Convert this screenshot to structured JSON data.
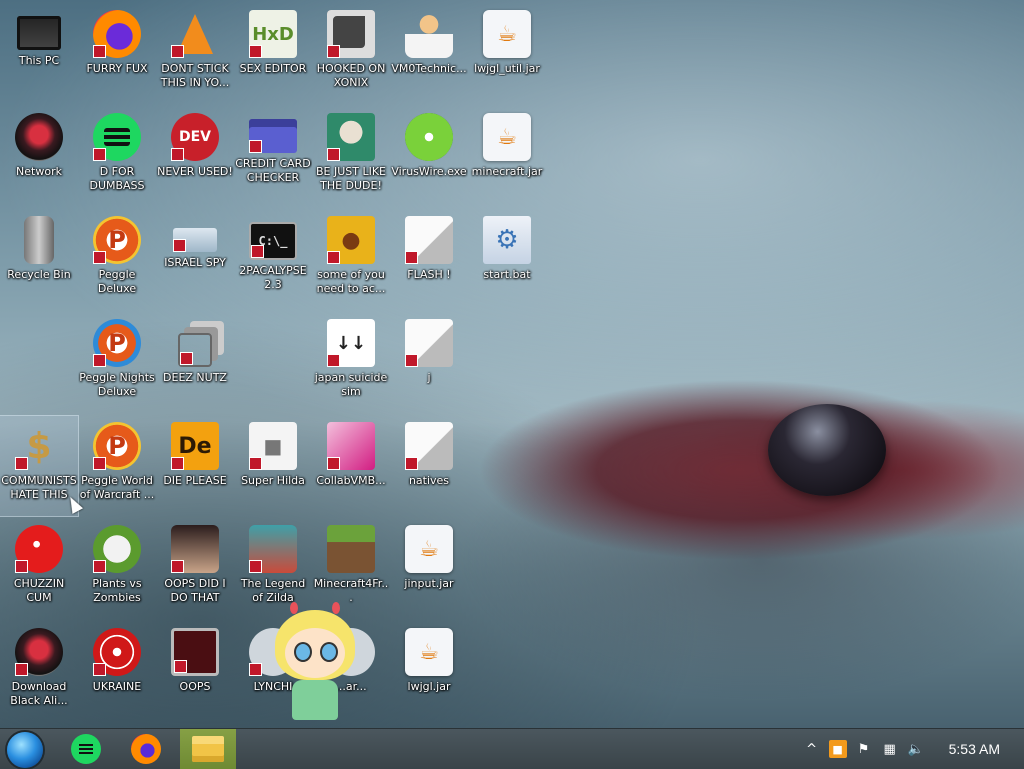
{
  "desktop": {
    "icons": [
      {
        "label": "This PC",
        "icon": "computer-icon",
        "shortcut": false
      },
      {
        "label": "FURRY FUX",
        "icon": "firefox-icon",
        "shortcut": true
      },
      {
        "label": "DONT STICK THIS IN YO...",
        "icon": "vlc-cone-icon",
        "shortcut": true
      },
      {
        "label": "SEX EDITOR",
        "icon": "hxd-editor-icon",
        "shortcut": true
      },
      {
        "label": "HOOKED ON XONIX",
        "icon": "xonix-icon",
        "shortcut": true
      },
      {
        "label": "VM0Technic...",
        "icon": "doctor-avatar-icon",
        "shortcut": false
      },
      {
        "label": "lwjgl_util.jar",
        "icon": "java-icon",
        "shortcut": false
      },
      {
        "label": "Network",
        "icon": "network-orb-icon",
        "shortcut": false
      },
      {
        "label": "D FOR DUMBASS",
        "icon": "spotify-icon",
        "shortcut": true
      },
      {
        "label": "NEVER USED!",
        "icon": "dev-cpp-icon",
        "shortcut": true
      },
      {
        "label": "CREDIT CARD CHECKER",
        "icon": "credit-card-icon",
        "shortcut": true
      },
      {
        "label": "BE JUST LIKE THE DUDE!",
        "icon": "santa-game-icon",
        "shortcut": true
      },
      {
        "label": "VirusWire.exe",
        "icon": "limewire-icon",
        "shortcut": false
      },
      {
        "label": "minecraft.jar",
        "icon": "java-icon",
        "shortcut": false
      },
      {
        "label": "Recycle Bin",
        "icon": "recycle-bin-icon",
        "shortcut": false
      },
      {
        "label": "Peggle Deluxe",
        "icon": "peggle-icon",
        "shortcut": true
      },
      {
        "label": "ISRAEL SPY",
        "icon": "network-drive-icon",
        "shortcut": true
      },
      {
        "label": "2PACALYPSE 2.3",
        "icon": "terminal-icon",
        "shortcut": true
      },
      {
        "label": "some of you need to ac...",
        "icon": "dog-icon",
        "shortcut": true
      },
      {
        "label": "FLASH !",
        "icon": "file-icon",
        "shortcut": true
      },
      {
        "label": "start.bat",
        "icon": "batch-gear-icon",
        "shortcut": false
      },
      {
        "label": "Peggle Nights Deluxe",
        "icon": "peggle-nights-icon",
        "shortcut": true
      },
      {
        "label": "DEEZ NUTZ",
        "icon": "stacked-windows-icon",
        "shortcut": true
      },
      {
        "label": "japan suicide sim",
        "icon": "japan-sim-icon",
        "shortcut": true
      },
      {
        "label": "j",
        "icon": "file-icon",
        "shortcut": true
      },
      {
        "label": "COMMUNISTS HATE THIS G...",
        "icon": "money-bag-icon",
        "shortcut": true
      },
      {
        "label": "Peggle World of Warcraft ...",
        "icon": "peggle-icon",
        "shortcut": true
      },
      {
        "label": "DIE PLEASE",
        "icon": "die-icon",
        "shortcut": true
      },
      {
        "label": "Super Hilda",
        "icon": "hilda-icon",
        "shortcut": true
      },
      {
        "label": "CollabVMB...",
        "icon": "collabvm-icon",
        "shortcut": true
      },
      {
        "label": "natives",
        "icon": "file-icon",
        "shortcut": true
      },
      {
        "label": "CHUZZIN CUM",
        "icon": "chuzzle-icon",
        "shortcut": true
      },
      {
        "label": "Plants vs Zombies",
        "icon": "pvz-icon",
        "shortcut": true
      },
      {
        "label": "OOPS DID I DO THAT",
        "icon": "portrait-icon",
        "shortcut": true
      },
      {
        "label": "The Legend of Zilda",
        "icon": "zelda-icon",
        "shortcut": true
      },
      {
        "label": "Minecraft4Fr...",
        "icon": "minecraft-icon",
        "shortcut": false
      },
      {
        "label": "jinput.jar",
        "icon": "java-icon",
        "shortcut": false
      },
      {
        "label": "Download Black Ali...",
        "icon": "network-orb-icon",
        "shortcut": true
      },
      {
        "label": "UKRAINE",
        "icon": "radiation-icon",
        "shortcut": true
      },
      {
        "label": "OOPS",
        "icon": "oops-app-icon",
        "shortcut": true
      },
      {
        "label": "LYNCHI",
        "icon": "generic-app-icon",
        "shortcut": true
      },
      {
        "label": "...ar...",
        "icon": "generic-app-icon",
        "shortcut": false
      },
      {
        "label": "lwjgl.jar",
        "icon": "java-icon",
        "shortcut": false
      }
    ]
  },
  "taskbar": {
    "start_icon": "start-orb-icon",
    "apps": [
      {
        "name": "spotify",
        "icon": "spotify-icon",
        "active": false
      },
      {
        "name": "firefox",
        "icon": "firefox-icon",
        "active": false
      },
      {
        "name": "file-explorer",
        "icon": "folder-icon",
        "active": true
      }
    ],
    "tray": {
      "chevron": "^",
      "icons": [
        "orange-app-icon",
        "flag-icon",
        "network-icon",
        "speaker-icon"
      ],
      "clock": "5:53 AM"
    }
  }
}
